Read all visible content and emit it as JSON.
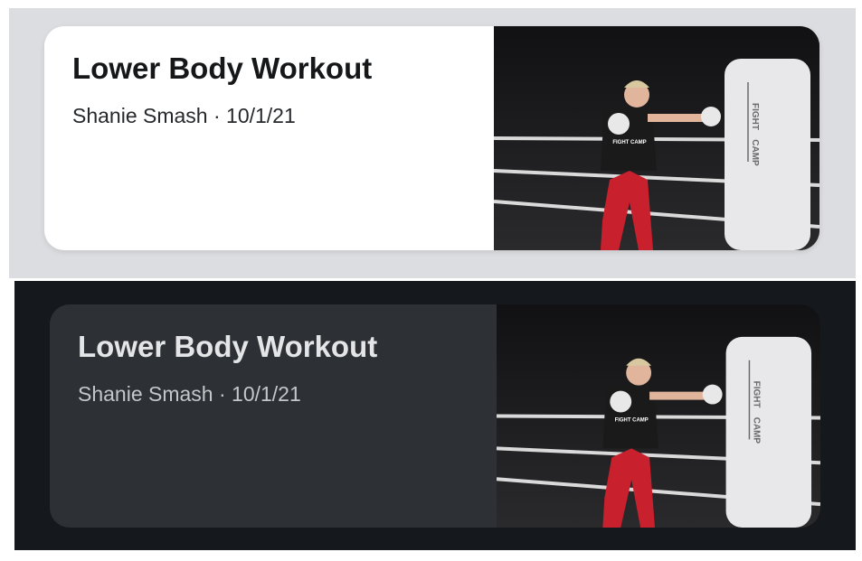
{
  "cards": [
    {
      "theme": "light",
      "title": "Lower Body Workout",
      "subtitle": "Shanie Smash · 10/1/21",
      "thumbnail": {
        "bag_text_1": "FIGHT",
        "bag_text_2": "CAMP",
        "shirt_text": "FIGHT CAMP"
      }
    },
    {
      "theme": "dark",
      "title": "Lower Body Workout",
      "subtitle": "Shanie Smash · 10/1/21",
      "thumbnail": {
        "bag_text_1": "FIGHT",
        "bag_text_2": "CAMP",
        "shirt_text": "FIGHT CAMP"
      }
    }
  ],
  "colors": {
    "light_bg": "#dcdde0",
    "dark_bg": "#15191d",
    "light_card": "#ffffff",
    "dark_card": "#2d3034",
    "pants": "#c8202c"
  }
}
